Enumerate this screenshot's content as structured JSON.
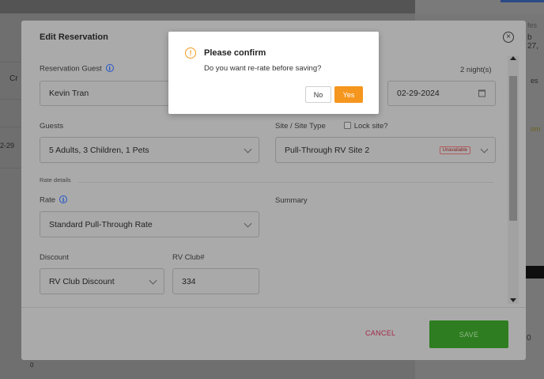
{
  "background": {
    "left_texts": [
      "Cr",
      "2-29",
      "0"
    ],
    "right_texts": [
      "fes",
      "b 27,",
      "om",
      "es"
    ],
    "right_dark": "0"
  },
  "modal": {
    "title": "Edit Reservation",
    "guest_label": "Reservation Guest",
    "guest_value": "Kevin Tran",
    "nights": "2 night(s)",
    "end_date": "02-29-2024",
    "guests_label": "Guests",
    "guests_value": "5 Adults, 3 Children, 1 Pets",
    "site_label": "Site / Site Type",
    "lock_label": "Lock site?",
    "site_value": "Pull-Through RV Site 2",
    "unavailable_badge": "Unavailable",
    "rate_details_label": "Rate details",
    "rate_label": "Rate",
    "rate_value": "Standard Pull-Through Rate",
    "summary_label": "Summary",
    "discount_label": "Discount",
    "discount_value": "RV Club Discount",
    "club_label": "RV Club#",
    "club_value": "334",
    "cancel_label": "CANCEL",
    "save_label": "SAVE"
  },
  "confirm": {
    "title": "Please confirm",
    "message": "Do you want re-rate before saving?",
    "no_label": "No",
    "yes_label": "Yes",
    "accent_color": "#f5961e"
  },
  "icons": {
    "close": "close-icon",
    "info": "info-icon",
    "warning": "warning-icon",
    "calendar": "calendar-icon",
    "chevron": "chevron-down-icon"
  }
}
